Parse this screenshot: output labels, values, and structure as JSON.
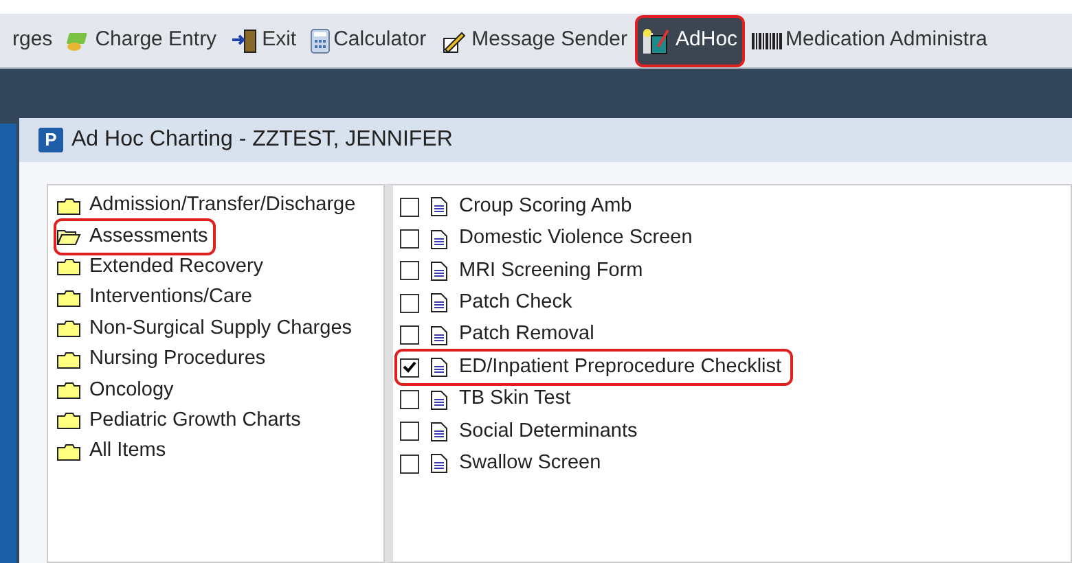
{
  "toolbar": {
    "items": [
      {
        "label": "rges",
        "kind": "none",
        "selected": false,
        "highlighted": false
      },
      {
        "label": "Charge Entry",
        "kind": "money",
        "selected": false,
        "highlighted": false
      },
      {
        "label": "Exit",
        "kind": "door",
        "selected": false,
        "highlighted": false
      },
      {
        "label": "Calculator",
        "kind": "calculator",
        "selected": false,
        "highlighted": false
      },
      {
        "label": "Message Sender",
        "kind": "pen",
        "selected": false,
        "highlighted": false
      },
      {
        "label": "AdHoc",
        "kind": "adhoc",
        "selected": true,
        "highlighted": true
      },
      {
        "label": "Medication Administra",
        "kind": "barcode",
        "selected": false,
        "highlighted": false
      }
    ]
  },
  "dialog": {
    "logo": "P",
    "title": "Ad Hoc Charting - ZZTEST, JENNIFER",
    "folders": [
      {
        "label": "Admission/Transfer/Discharge",
        "selected": false,
        "highlighted": false
      },
      {
        "label": "Assessments",
        "selected": true,
        "highlighted": true
      },
      {
        "label": "Extended Recovery",
        "selected": false,
        "highlighted": false
      },
      {
        "label": "Interventions/Care",
        "selected": false,
        "highlighted": false
      },
      {
        "label": "Non-Surgical Supply Charges",
        "selected": false,
        "highlighted": false
      },
      {
        "label": "Nursing Procedures",
        "selected": false,
        "highlighted": false
      },
      {
        "label": "Oncology",
        "selected": false,
        "highlighted": false
      },
      {
        "label": "Pediatric Growth Charts",
        "selected": false,
        "highlighted": false
      },
      {
        "label": "All Items",
        "selected": false,
        "highlighted": false
      }
    ],
    "forms": [
      {
        "label": "Croup Scoring Amb",
        "checked": false,
        "highlighted": false
      },
      {
        "label": "Domestic Violence Screen",
        "checked": false,
        "highlighted": false
      },
      {
        "label": "MRI Screening Form",
        "checked": false,
        "highlighted": false
      },
      {
        "label": "Patch Check",
        "checked": false,
        "highlighted": false
      },
      {
        "label": "Patch Removal",
        "checked": false,
        "highlighted": false
      },
      {
        "label": "ED/Inpatient Preprocedure Checklist",
        "checked": true,
        "highlighted": true
      },
      {
        "label": "TB Skin Test",
        "checked": false,
        "highlighted": false
      },
      {
        "label": "Social Determinants",
        "checked": false,
        "highlighted": false
      },
      {
        "label": "Swallow Screen",
        "checked": false,
        "highlighted": false
      }
    ]
  }
}
